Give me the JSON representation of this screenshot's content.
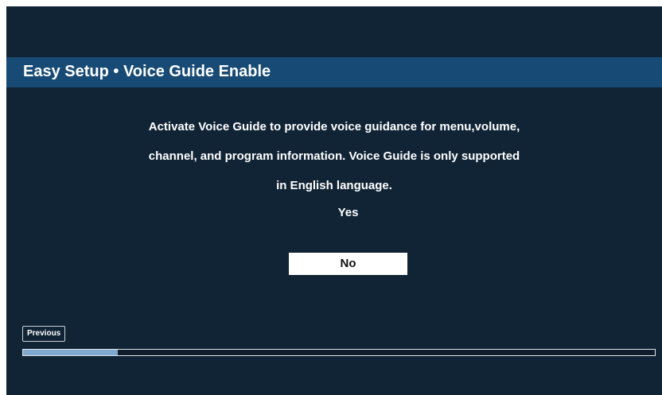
{
  "header": {
    "title": "Easy Setup • Voice Guide Enable"
  },
  "message": {
    "lines": [
      "Activate Voice Guide to provide voice guidance for menu,volume,",
      "channel, and program information. Voice Guide is only supported",
      "in English language."
    ]
  },
  "options": {
    "yes_label": "Yes",
    "no_label": "No",
    "selected": "No"
  },
  "footer": {
    "previous_label": "Previous"
  },
  "progress": {
    "fraction": 0.15
  },
  "colors": {
    "background": "#112436",
    "title_bar": "#174a74",
    "selection": "#ffffff",
    "progress_fill": "#7fa8cf"
  }
}
